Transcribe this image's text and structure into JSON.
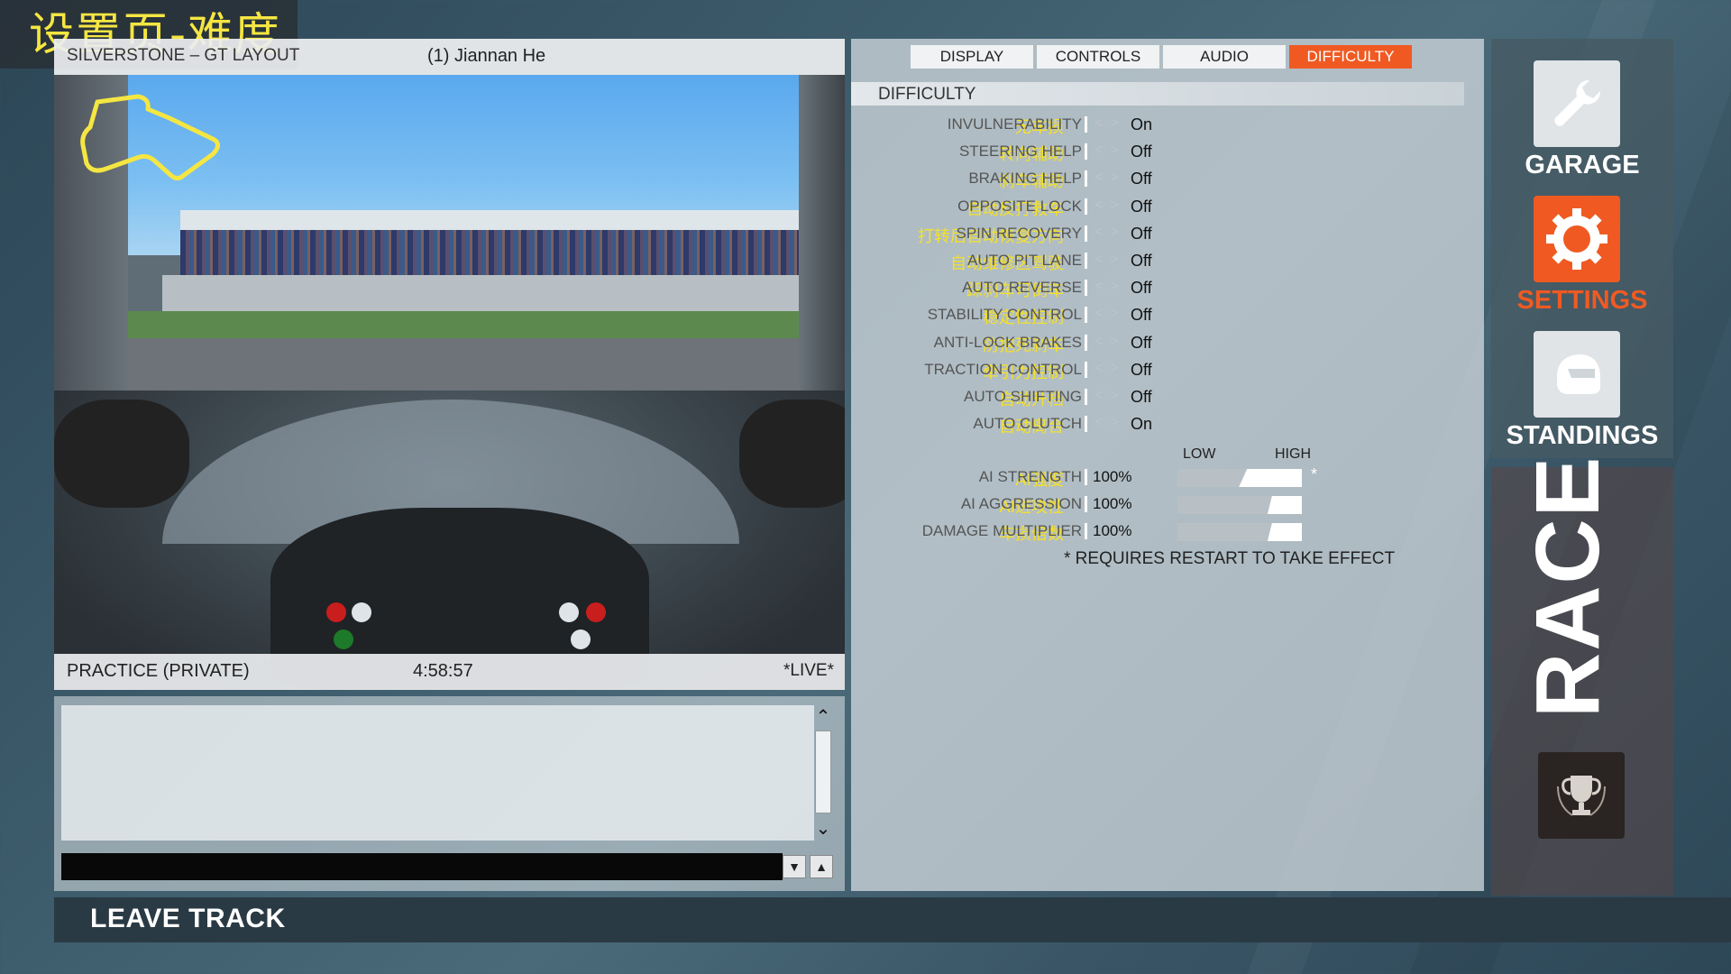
{
  "annotation": "设置页-难度",
  "viewport": {
    "track_name": "SILVERSTONE – GT LAYOUT",
    "driver": "(1) Jiannan He",
    "session": "PRACTICE (PRIVATE)",
    "time": "4:58:57",
    "live": "*LIVE*"
  },
  "chat": {
    "scroll_up_icon": "chevron-up-icon",
    "scroll_down_icon": "chevron-down-icon",
    "input_value": "",
    "buttons": [
      "thumbs-down-icon",
      "thumbs-up-icon"
    ]
  },
  "leave_track": "LEAVE TRACK",
  "tabs": [
    {
      "label": "DISPLAY"
    },
    {
      "label": "CONTROLS"
    },
    {
      "label": "AUDIO"
    },
    {
      "label": "DIFFICULTY",
      "active": true
    }
  ],
  "difficulty": {
    "title": "DIFFICULTY",
    "options": [
      {
        "cn": "无车损",
        "en": "INVULNERABILITY",
        "value": "On"
      },
      {
        "cn": "转向辅助",
        "en": "STEERING HELP",
        "value": "Off"
      },
      {
        "cn": "刹车辅助",
        "en": "BRAKING HELP",
        "value": "Off"
      },
      {
        "cn": "自动反打救车",
        "en": "OPPOSITE LOCK",
        "value": "Off"
      },
      {
        "cn": "打转后自动恢复方向",
        "en": "SPIN RECOVERY",
        "value": "Off"
      },
      {
        "cn": "自动维修区驾驶",
        "en": "AUTO PIT LANE",
        "value": "Off"
      },
      {
        "cn": "踩刹车可倒车",
        "en": "AUTO REVERSE",
        "value": "Off"
      },
      {
        "cn": "稳定性控制",
        "en": "STABILITY CONTROL",
        "value": "Off"
      },
      {
        "cn": "防抱死刹车",
        "en": "ANTI-LOCK BRAKES",
        "value": "Off"
      },
      {
        "cn": "牵引力控制",
        "en": "TRACTION CONTROL",
        "value": "Off"
      },
      {
        "cn": "自动升档",
        "en": "AUTO SHIFTING",
        "value": "Off"
      },
      {
        "cn": "自动离合",
        "en": "AUTO CLUTCH",
        "value": "On"
      }
    ],
    "low_label": "LOW",
    "high_label": "HIGH",
    "sliders": [
      {
        "cn": "AI强度",
        "en": "AI STRENGTH",
        "value": "100%",
        "level": 1.0,
        "note": "*"
      },
      {
        "cn": "AI进攻性",
        "en": "AI AGGRESSION",
        "value": "100%",
        "level": 1.0,
        "note": ""
      },
      {
        "cn": "车损倍数",
        "en": "DAMAGE MULTIPLIER",
        "value": "100%",
        "level": 1.0,
        "note": ""
      }
    ],
    "restart_note": "* REQUIRES RESTART TO TAKE EFFECT"
  },
  "nav": {
    "garage": "GARAGE",
    "settings": "SETTINGS",
    "standings": "STANDINGS",
    "race": "RACE"
  },
  "colors": {
    "accent": "#f05a22",
    "cn_text": "#f5e128",
    "track_map": "#f5e642"
  }
}
